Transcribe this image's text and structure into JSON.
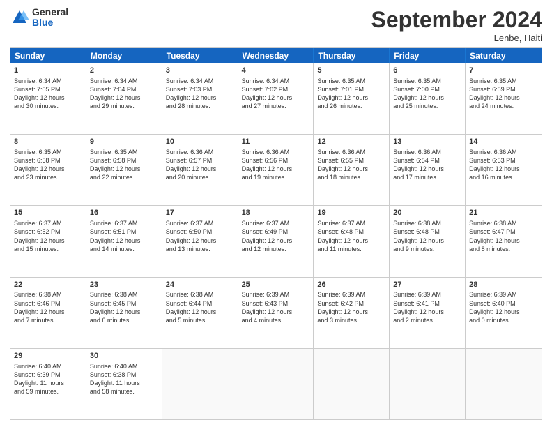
{
  "logo": {
    "text_general": "General",
    "text_blue": "Blue"
  },
  "title": "September 2024",
  "location": "Lenbe, Haiti",
  "days_of_week": [
    "Sunday",
    "Monday",
    "Tuesday",
    "Wednesday",
    "Thursday",
    "Friday",
    "Saturday"
  ],
  "weeks": [
    [
      {
        "day": "1",
        "lines": [
          "Sunrise: 6:34 AM",
          "Sunset: 7:05 PM",
          "Daylight: 12 hours",
          "and 30 minutes."
        ]
      },
      {
        "day": "2",
        "lines": [
          "Sunrise: 6:34 AM",
          "Sunset: 7:04 PM",
          "Daylight: 12 hours",
          "and 29 minutes."
        ]
      },
      {
        "day": "3",
        "lines": [
          "Sunrise: 6:34 AM",
          "Sunset: 7:03 PM",
          "Daylight: 12 hours",
          "and 28 minutes."
        ]
      },
      {
        "day": "4",
        "lines": [
          "Sunrise: 6:34 AM",
          "Sunset: 7:02 PM",
          "Daylight: 12 hours",
          "and 27 minutes."
        ]
      },
      {
        "day": "5",
        "lines": [
          "Sunrise: 6:35 AM",
          "Sunset: 7:01 PM",
          "Daylight: 12 hours",
          "and 26 minutes."
        ]
      },
      {
        "day": "6",
        "lines": [
          "Sunrise: 6:35 AM",
          "Sunset: 7:00 PM",
          "Daylight: 12 hours",
          "and 25 minutes."
        ]
      },
      {
        "day": "7",
        "lines": [
          "Sunrise: 6:35 AM",
          "Sunset: 6:59 PM",
          "Daylight: 12 hours",
          "and 24 minutes."
        ]
      }
    ],
    [
      {
        "day": "8",
        "lines": [
          "Sunrise: 6:35 AM",
          "Sunset: 6:58 PM",
          "Daylight: 12 hours",
          "and 23 minutes."
        ]
      },
      {
        "day": "9",
        "lines": [
          "Sunrise: 6:35 AM",
          "Sunset: 6:58 PM",
          "Daylight: 12 hours",
          "and 22 minutes."
        ]
      },
      {
        "day": "10",
        "lines": [
          "Sunrise: 6:36 AM",
          "Sunset: 6:57 PM",
          "Daylight: 12 hours",
          "and 20 minutes."
        ]
      },
      {
        "day": "11",
        "lines": [
          "Sunrise: 6:36 AM",
          "Sunset: 6:56 PM",
          "Daylight: 12 hours",
          "and 19 minutes."
        ]
      },
      {
        "day": "12",
        "lines": [
          "Sunrise: 6:36 AM",
          "Sunset: 6:55 PM",
          "Daylight: 12 hours",
          "and 18 minutes."
        ]
      },
      {
        "day": "13",
        "lines": [
          "Sunrise: 6:36 AM",
          "Sunset: 6:54 PM",
          "Daylight: 12 hours",
          "and 17 minutes."
        ]
      },
      {
        "day": "14",
        "lines": [
          "Sunrise: 6:36 AM",
          "Sunset: 6:53 PM",
          "Daylight: 12 hours",
          "and 16 minutes."
        ]
      }
    ],
    [
      {
        "day": "15",
        "lines": [
          "Sunrise: 6:37 AM",
          "Sunset: 6:52 PM",
          "Daylight: 12 hours",
          "and 15 minutes."
        ]
      },
      {
        "day": "16",
        "lines": [
          "Sunrise: 6:37 AM",
          "Sunset: 6:51 PM",
          "Daylight: 12 hours",
          "and 14 minutes."
        ]
      },
      {
        "day": "17",
        "lines": [
          "Sunrise: 6:37 AM",
          "Sunset: 6:50 PM",
          "Daylight: 12 hours",
          "and 13 minutes."
        ]
      },
      {
        "day": "18",
        "lines": [
          "Sunrise: 6:37 AM",
          "Sunset: 6:49 PM",
          "Daylight: 12 hours",
          "and 12 minutes."
        ]
      },
      {
        "day": "19",
        "lines": [
          "Sunrise: 6:37 AM",
          "Sunset: 6:48 PM",
          "Daylight: 12 hours",
          "and 11 minutes."
        ]
      },
      {
        "day": "20",
        "lines": [
          "Sunrise: 6:38 AM",
          "Sunset: 6:48 PM",
          "Daylight: 12 hours",
          "and 9 minutes."
        ]
      },
      {
        "day": "21",
        "lines": [
          "Sunrise: 6:38 AM",
          "Sunset: 6:47 PM",
          "Daylight: 12 hours",
          "and 8 minutes."
        ]
      }
    ],
    [
      {
        "day": "22",
        "lines": [
          "Sunrise: 6:38 AM",
          "Sunset: 6:46 PM",
          "Daylight: 12 hours",
          "and 7 minutes."
        ]
      },
      {
        "day": "23",
        "lines": [
          "Sunrise: 6:38 AM",
          "Sunset: 6:45 PM",
          "Daylight: 12 hours",
          "and 6 minutes."
        ]
      },
      {
        "day": "24",
        "lines": [
          "Sunrise: 6:38 AM",
          "Sunset: 6:44 PM",
          "Daylight: 12 hours",
          "and 5 minutes."
        ]
      },
      {
        "day": "25",
        "lines": [
          "Sunrise: 6:39 AM",
          "Sunset: 6:43 PM",
          "Daylight: 12 hours",
          "and 4 minutes."
        ]
      },
      {
        "day": "26",
        "lines": [
          "Sunrise: 6:39 AM",
          "Sunset: 6:42 PM",
          "Daylight: 12 hours",
          "and 3 minutes."
        ]
      },
      {
        "day": "27",
        "lines": [
          "Sunrise: 6:39 AM",
          "Sunset: 6:41 PM",
          "Daylight: 12 hours",
          "and 2 minutes."
        ]
      },
      {
        "day": "28",
        "lines": [
          "Sunrise: 6:39 AM",
          "Sunset: 6:40 PM",
          "Daylight: 12 hours",
          "and 0 minutes."
        ]
      }
    ],
    [
      {
        "day": "29",
        "lines": [
          "Sunrise: 6:40 AM",
          "Sunset: 6:39 PM",
          "Daylight: 11 hours",
          "and 59 minutes."
        ]
      },
      {
        "day": "30",
        "lines": [
          "Sunrise: 6:40 AM",
          "Sunset: 6:38 PM",
          "Daylight: 11 hours",
          "and 58 minutes."
        ]
      },
      {
        "day": "",
        "lines": []
      },
      {
        "day": "",
        "lines": []
      },
      {
        "day": "",
        "lines": []
      },
      {
        "day": "",
        "lines": []
      },
      {
        "day": "",
        "lines": []
      }
    ]
  ]
}
